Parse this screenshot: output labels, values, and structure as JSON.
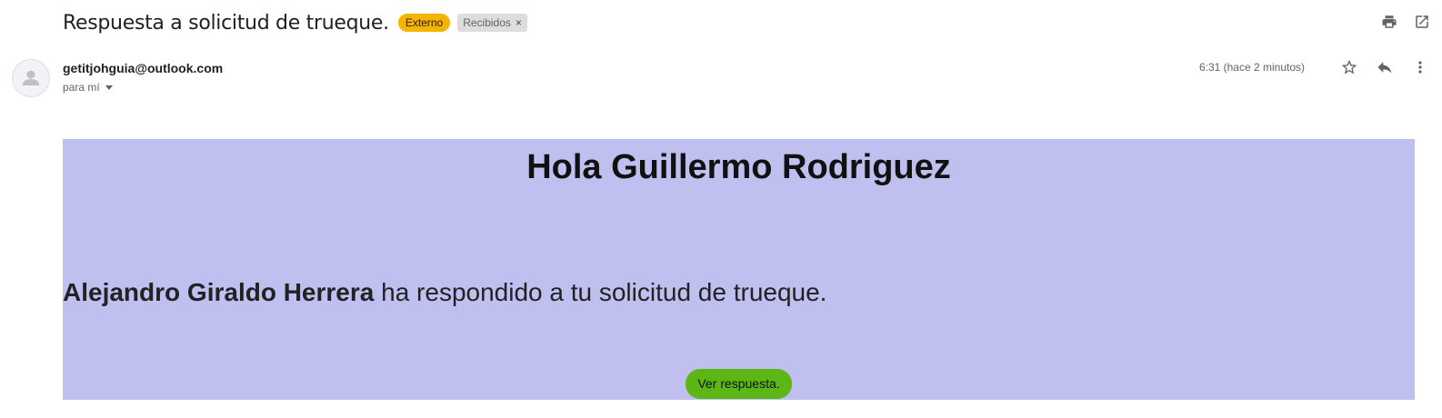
{
  "email": {
    "subject": "Respuesta a solicitud de trueque.",
    "labels": {
      "external": "Externo",
      "inbox": "Recibidos",
      "inbox_remove": "×"
    },
    "sender": "getitjohguia@outlook.com",
    "to": "para mí",
    "time": "6:31 (hace 2 minutos)"
  },
  "icons": {
    "print": "print-icon",
    "open_new_window": "open-in-new-window-icon",
    "star": "star-icon",
    "reply": "reply-icon",
    "more": "more-vert-icon",
    "avatar": "default-avatar-icon"
  },
  "body": {
    "greeting": "Hola Guillermo Rodriguez",
    "responder_name": "Alejandro Giraldo Herrera",
    "message_rest": " ha respondido a tu solicitud de trueque.",
    "cta": "Ver respuesta."
  },
  "colors": {
    "body_bg": "#bfbff0",
    "cta_bg": "#5cb615",
    "external_badge": "#f4b400",
    "inbox_badge": "#dddddd"
  }
}
